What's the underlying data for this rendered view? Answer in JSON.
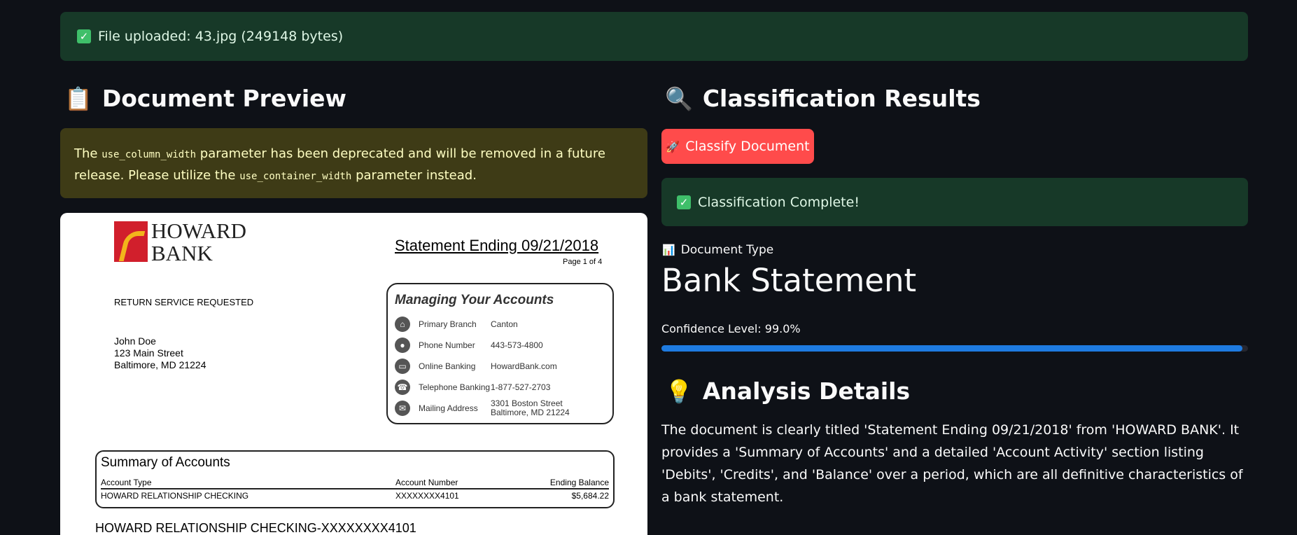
{
  "upload_banner": {
    "text": "File uploaded: 43.jpg (249148 bytes)"
  },
  "preview": {
    "heading_icon": "📋",
    "heading": "Document Preview",
    "warning": {
      "part1": "The ",
      "code1": "use_column_width",
      "part2": " parameter has been deprecated and will be removed in a future release. Please utilize the ",
      "code2": "use_container_width",
      "part3": " parameter instead."
    },
    "document": {
      "bank_name_line1": "HOWARD",
      "bank_name_line2": "BANK",
      "statement_title": "Statement Ending 09/21/2018",
      "page_number": "Page 1 of 4",
      "return_notice": "RETURN SERVICE REQUESTED",
      "customer": {
        "name": "John Doe",
        "street": "123 Main Street",
        "city": "Baltimore, MD 21224"
      },
      "manage_box": {
        "title": "Managing Your Accounts",
        "rows": [
          {
            "icon": "bank-icon",
            "label": "Primary Branch",
            "value": "Canton"
          },
          {
            "icon": "person-icon",
            "label": "Phone Number",
            "value": "443-573-4800"
          },
          {
            "icon": "computer-icon",
            "label": "Online Banking",
            "value": "HowardBank.com"
          },
          {
            "icon": "telephone-icon",
            "label": "Telephone Banking",
            "value": "1-877-527-2703"
          },
          {
            "icon": "mail-icon",
            "label": "Mailing Address",
            "value": "3301 Boston Street Baltimore, MD 21224"
          }
        ]
      },
      "summary": {
        "title": "Summary of Accounts",
        "headers": [
          "Account Type",
          "Account Number",
          "Ending Balance"
        ],
        "rows": [
          [
            "HOWARD RELATIONSHIP CHECKING",
            "XXXXXXXX4101",
            "$5,684.22"
          ]
        ]
      },
      "account_heading": "HOWARD RELATIONSHIP CHECKING-XXXXXXXX4101"
    }
  },
  "results": {
    "heading_icon": "🔍",
    "heading": "Classification Results",
    "classify_button": "Classify Document",
    "success_text": "Classification Complete!",
    "doc_type_label": "Document Type",
    "doc_type_value": "Bank Statement",
    "confidence_label": "Confidence Level: 99.0%",
    "confidence_value": 0.99
  },
  "analysis": {
    "heading_icon": "💡",
    "heading": "Analysis Details",
    "text": "The document is clearly titled 'Statement Ending 09/21/2018' from 'HOWARD BANK'. It provides a 'Summary of Accounts' and a detailed 'Account Activity' section listing 'Debits', 'Credits', and 'Balance' over a period, which are all definitive characteristics of a bank statement."
  },
  "colors": {
    "background": "#0e1117",
    "success_bg": "#173928",
    "warning_bg": "#3e3b16",
    "primary_button": "#ff4b4b",
    "progress": "#1e7be0"
  }
}
